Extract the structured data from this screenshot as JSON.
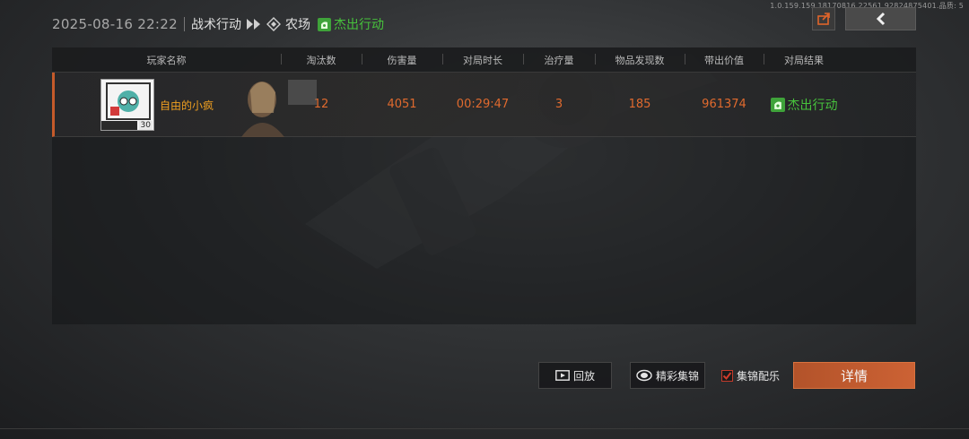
{
  "version_text": "1.0.159.159.18170816.22561.92824875401.品质: 5",
  "header": {
    "datetime": "2025-08-16 22:22",
    "mode": "战术行动",
    "map": "农场",
    "result": "杰出行动"
  },
  "table": {
    "columns": [
      "玩家名称",
      "淘汰数",
      "伤害量",
      "对局时长",
      "治疗量",
      "物品发现数",
      "带出价值",
      "对局结果"
    ],
    "rows": [
      {
        "player_name": "自由的小疯",
        "level": "30",
        "kills": "12",
        "damage": "4051",
        "duration": "00:29:47",
        "healing": "3",
        "items_found": "185",
        "extract_value": "961374",
        "result": "杰出行动"
      }
    ]
  },
  "footer": {
    "replay_label": "回放",
    "highlights_label": "精彩集锦",
    "music_label": "集锦配乐",
    "music_checked": true,
    "details_label": "详情"
  },
  "colors": {
    "accent_orange": "#e06a2e",
    "success_green": "#47c23c",
    "name_gold": "#f0a020"
  },
  "icons": [
    "map-diamond-icon",
    "extract-result-icon",
    "share-icon",
    "back-icon",
    "replay-icon",
    "highlights-icon",
    "checkbox-icon"
  ]
}
